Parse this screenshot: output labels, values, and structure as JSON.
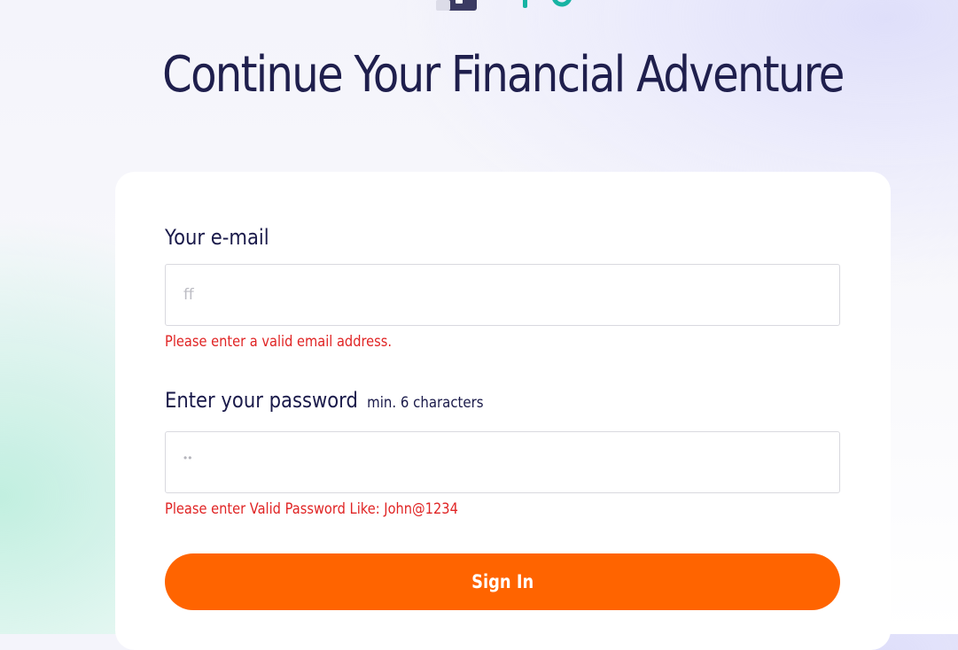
{
  "page": {
    "title": "Continue Your Financial Adventure"
  },
  "email": {
    "label": "Your e-mail",
    "value": "ff",
    "error": "Please enter a valid email address."
  },
  "password": {
    "label": "Enter your password",
    "hint": "min. 6 characters",
    "masked_value": "••",
    "error": "Please enter Valid Password Like: John@1234"
  },
  "actions": {
    "signin_label": "Sign In"
  },
  "colors": {
    "accent": "#ff6400",
    "heading": "#1f1f4d",
    "error": "#e02424",
    "logo_teal": "#17b3a3"
  },
  "icons": {
    "logo": "brand-logo-icon"
  }
}
